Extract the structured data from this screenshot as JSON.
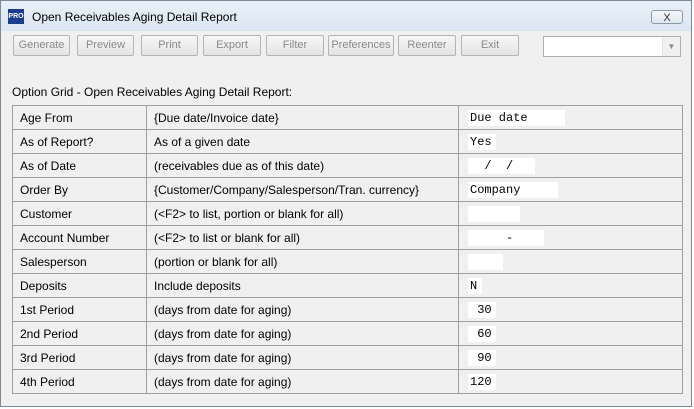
{
  "window": {
    "title": "Open Receivables Aging Detail Report",
    "app_icon_label": "PRO",
    "close_label": "X"
  },
  "toolbar": {
    "buttons": [
      "Generate",
      "Preview",
      "Print",
      "Export",
      "Filter",
      "Preferences",
      "Reenter",
      "Exit"
    ],
    "combo_value": ""
  },
  "grid": {
    "caption": "Option Grid -  Open Receivables Aging Detail Report:",
    "rows": [
      {
        "name": "Age From",
        "desc": "{Due date/Invoice date}",
        "value": "Due date"
      },
      {
        "name": "As of Report?",
        "desc": "As of a given date",
        "value": "Yes"
      },
      {
        "name": "As of Date",
        "desc": "(receivables due as of this date)",
        "value": "  /  /"
      },
      {
        "name": "Order By",
        "desc": "{Customer/Company/Salesperson/Tran. currency}",
        "value": "Company"
      },
      {
        "name": "Customer",
        "desc": "(<F2> to list, portion or blank for all)",
        "value": ""
      },
      {
        "name": "Account Number",
        "desc": "(<F2> to list or blank for all)",
        "value": "     -"
      },
      {
        "name": "Salesperson",
        "desc": "(portion or blank for all)",
        "value": ""
      },
      {
        "name": "Deposits",
        "desc": "Include deposits",
        "value": "N"
      },
      {
        "name": "1st Period",
        "desc": "(days from date for aging)",
        "value": " 30"
      },
      {
        "name": "2nd Period",
        "desc": "(days from date for aging)",
        "value": " 60"
      },
      {
        "name": "3rd Period",
        "desc": "(days from date for aging)",
        "value": " 90"
      },
      {
        "name": "4th Period",
        "desc": "(days from date for aging)",
        "value": "120"
      }
    ]
  }
}
